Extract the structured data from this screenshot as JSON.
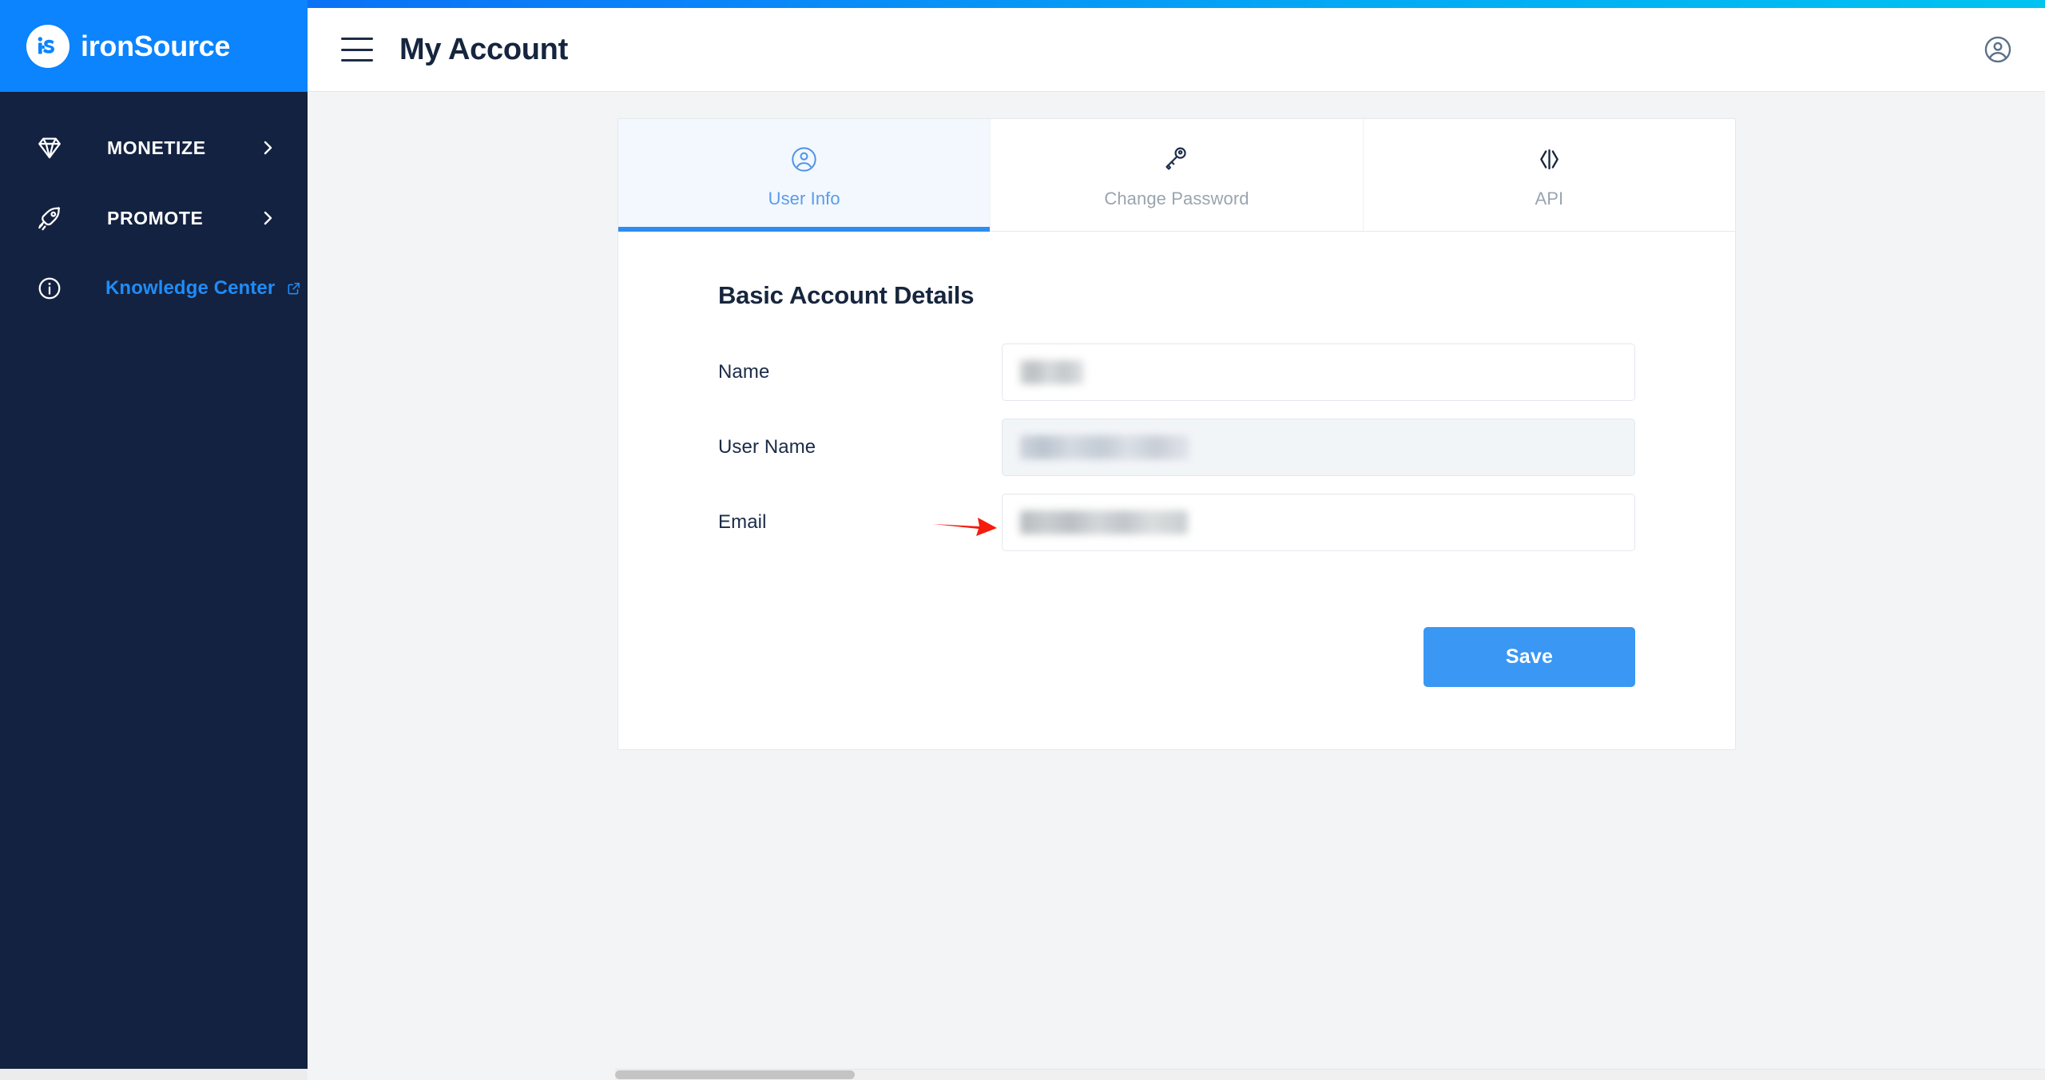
{
  "brand": {
    "logo_mark_text": "iS",
    "logo_word": "ironSource",
    "logo_bg": "#0b84fe",
    "sidebar_bg": "#132240",
    "accent": "#2d8cf0",
    "link_color": "#1f8cf7"
  },
  "sidebar": {
    "items": [
      {
        "label": "MONETIZE",
        "icon": "diamond-icon",
        "chevron": "chevron-right-icon",
        "type": "group"
      },
      {
        "label": "PROMOTE",
        "icon": "rocket-icon",
        "chevron": "chevron-right-icon",
        "type": "group"
      },
      {
        "label": "Knowledge Center",
        "icon": "info-circle-icon",
        "chevron": "external-link-icon",
        "type": "link"
      }
    ]
  },
  "topbar": {
    "menu_icon": "hamburger-icon",
    "title": "My Account",
    "account_icon": "account-circle-icon"
  },
  "tabs": [
    {
      "label": "User Info",
      "icon": "user-circle-icon",
      "active": true
    },
    {
      "label": "Change Password",
      "icon": "key-icon",
      "active": false
    },
    {
      "label": "API",
      "icon": "code-brackets-icon",
      "active": false
    }
  ],
  "form": {
    "section_title": "Basic Account Details",
    "fields": [
      {
        "label": "Name",
        "value": "",
        "placeholder": "",
        "redacted": true,
        "disabled": false
      },
      {
        "label": "User Name",
        "value": "",
        "placeholder": "",
        "redacted": true,
        "disabled": true
      },
      {
        "label": "Email",
        "value": "",
        "placeholder": "",
        "redacted": true,
        "disabled": false
      }
    ],
    "save_label": "Save"
  },
  "annotation": {
    "type": "arrow",
    "color": "#f51b0d",
    "points_to": "User Name"
  }
}
